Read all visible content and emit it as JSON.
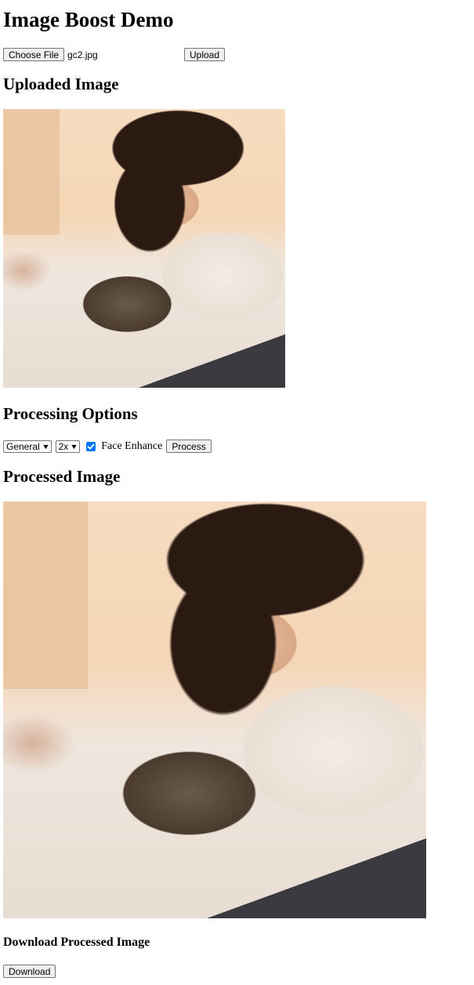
{
  "page": {
    "title": "Image Boost Demo"
  },
  "upload": {
    "choose_file_label": "Choose File",
    "file_name": "gc2.jpg",
    "upload_label": "Upload"
  },
  "uploaded": {
    "heading": "Uploaded Image"
  },
  "options": {
    "heading": "Processing Options",
    "model_selected": "General",
    "scale_selected": "2x",
    "face_enhance_label": "Face Enhance",
    "face_enhance_checked": true,
    "process_label": "Process"
  },
  "processed": {
    "heading": "Processed Image"
  },
  "download": {
    "heading": "Download Processed Image",
    "button_label": "Download"
  },
  "colors": {
    "checkbox_accent": "#0075ff"
  }
}
